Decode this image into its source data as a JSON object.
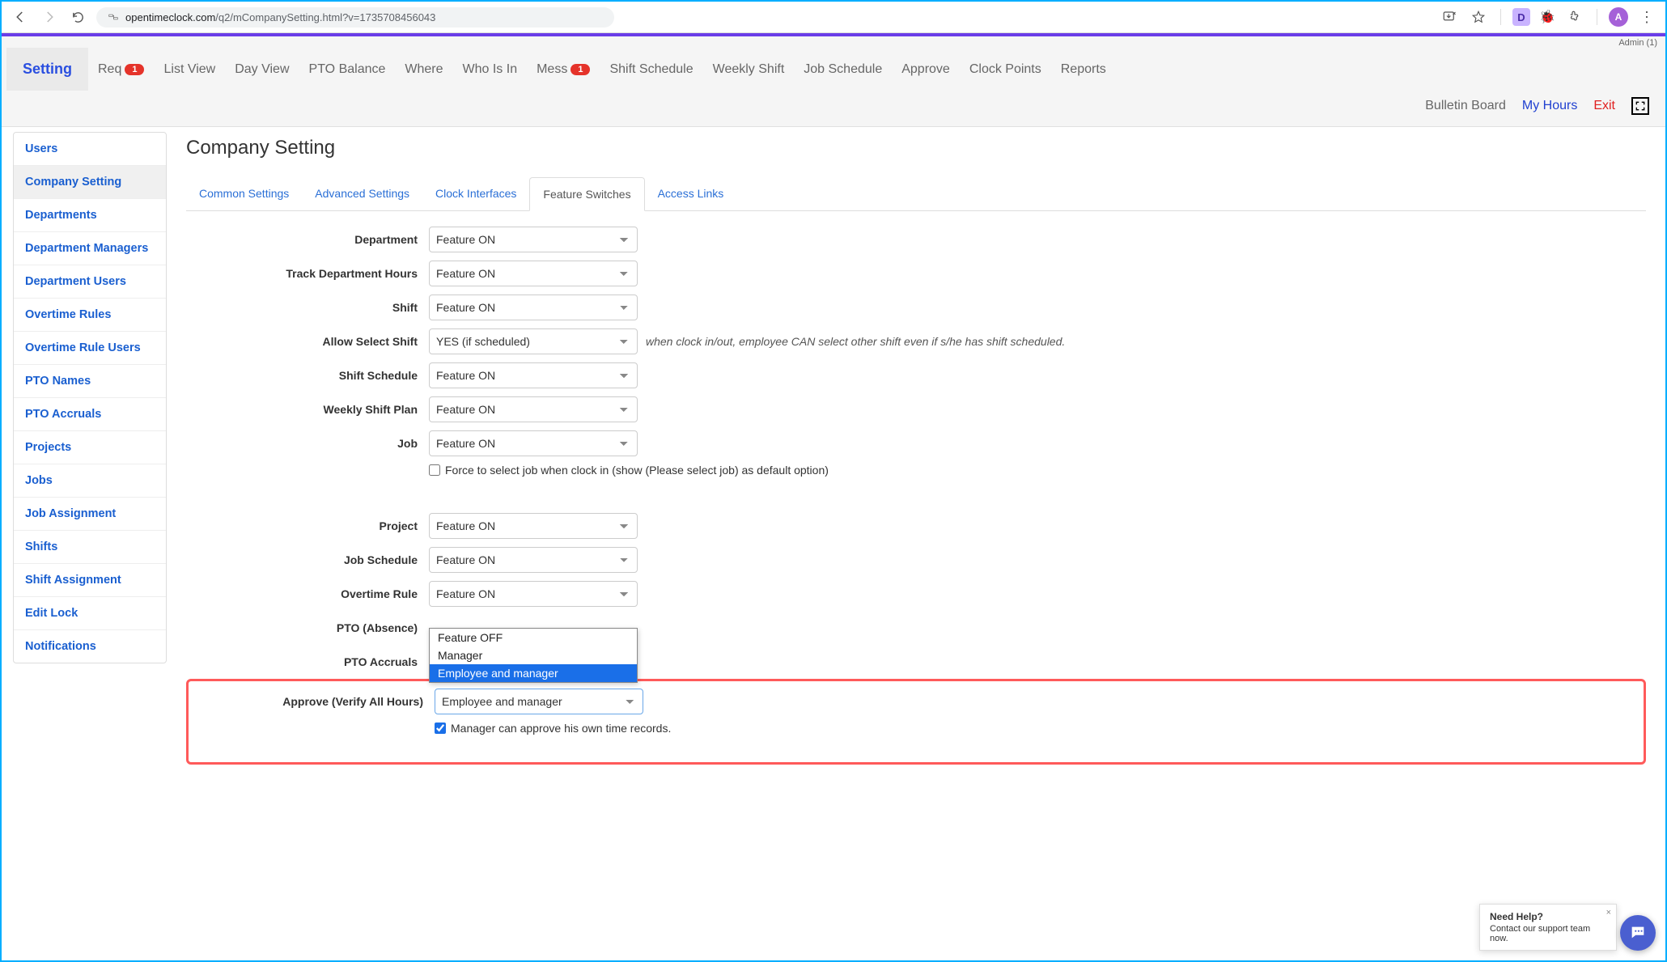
{
  "browser": {
    "url_host": "opentimeclock.com",
    "url_path": "/q2/mCompanySetting.html?v=1735708456043",
    "avatar_letter": "A"
  },
  "admin_label": "Admin (1)",
  "topnav": {
    "active": "Setting",
    "items": [
      "Setting",
      "Req",
      "List View",
      "Day View",
      "PTO Balance",
      "Where",
      "Who Is In",
      "Mess",
      "Shift Schedule",
      "Weekly Shift",
      "Job Schedule",
      "Approve",
      "Clock Points",
      "Reports"
    ],
    "req_badge": "1",
    "mess_badge": "1",
    "row2": [
      "Bulletin Board",
      "My Hours",
      "Exit"
    ]
  },
  "sidebar": {
    "items": [
      "Users",
      "Company Setting",
      "Departments",
      "Department Managers",
      "Department Users",
      "Overtime Rules",
      "Overtime Rule Users",
      "PTO Names",
      "PTO Accruals",
      "Projects",
      "Jobs",
      "Job Assignment",
      "Shifts",
      "Shift Assignment",
      "Edit Lock",
      "Notifications"
    ],
    "active": "Company Setting"
  },
  "page_title": "Company Setting",
  "subtabs": {
    "items": [
      "Common Settings",
      "Advanced Settings",
      "Clock Interfaces",
      "Feature Switches",
      "Access Links"
    ],
    "active": "Feature Switches"
  },
  "select_values": {
    "feature_on": "Feature ON",
    "yes_if_scheduled": "YES (if scheduled)",
    "employee_and_manager": "Employee and manager"
  },
  "rows": {
    "department": "Department",
    "track_dept_hours": "Track Department Hours",
    "shift": "Shift",
    "allow_select_shift": "Allow Select Shift",
    "allow_select_shift_note": "when clock in/out, employee CAN select other shift even if s/he has shift scheduled.",
    "shift_schedule": "Shift Schedule",
    "weekly_shift_plan": "Weekly Shift Plan",
    "job": "Job",
    "job_force_check": "Force to select job when clock in (show (Please select job) as default option)",
    "project": "Project",
    "job_schedule": "Job Schedule",
    "overtime_rule": "Overtime Rule",
    "pto_absence": "PTO (Absence)",
    "pto_accruals": "PTO Accruals",
    "approve": "Approve (Verify All Hours)",
    "approve_check": "Manager can approve his own time records."
  },
  "open_dropdown": {
    "options": [
      "Feature OFF",
      "Manager",
      "Employee and manager"
    ],
    "selected": "Employee and manager"
  },
  "help": {
    "title": "Need Help?",
    "sub": "Contact our support team now."
  }
}
